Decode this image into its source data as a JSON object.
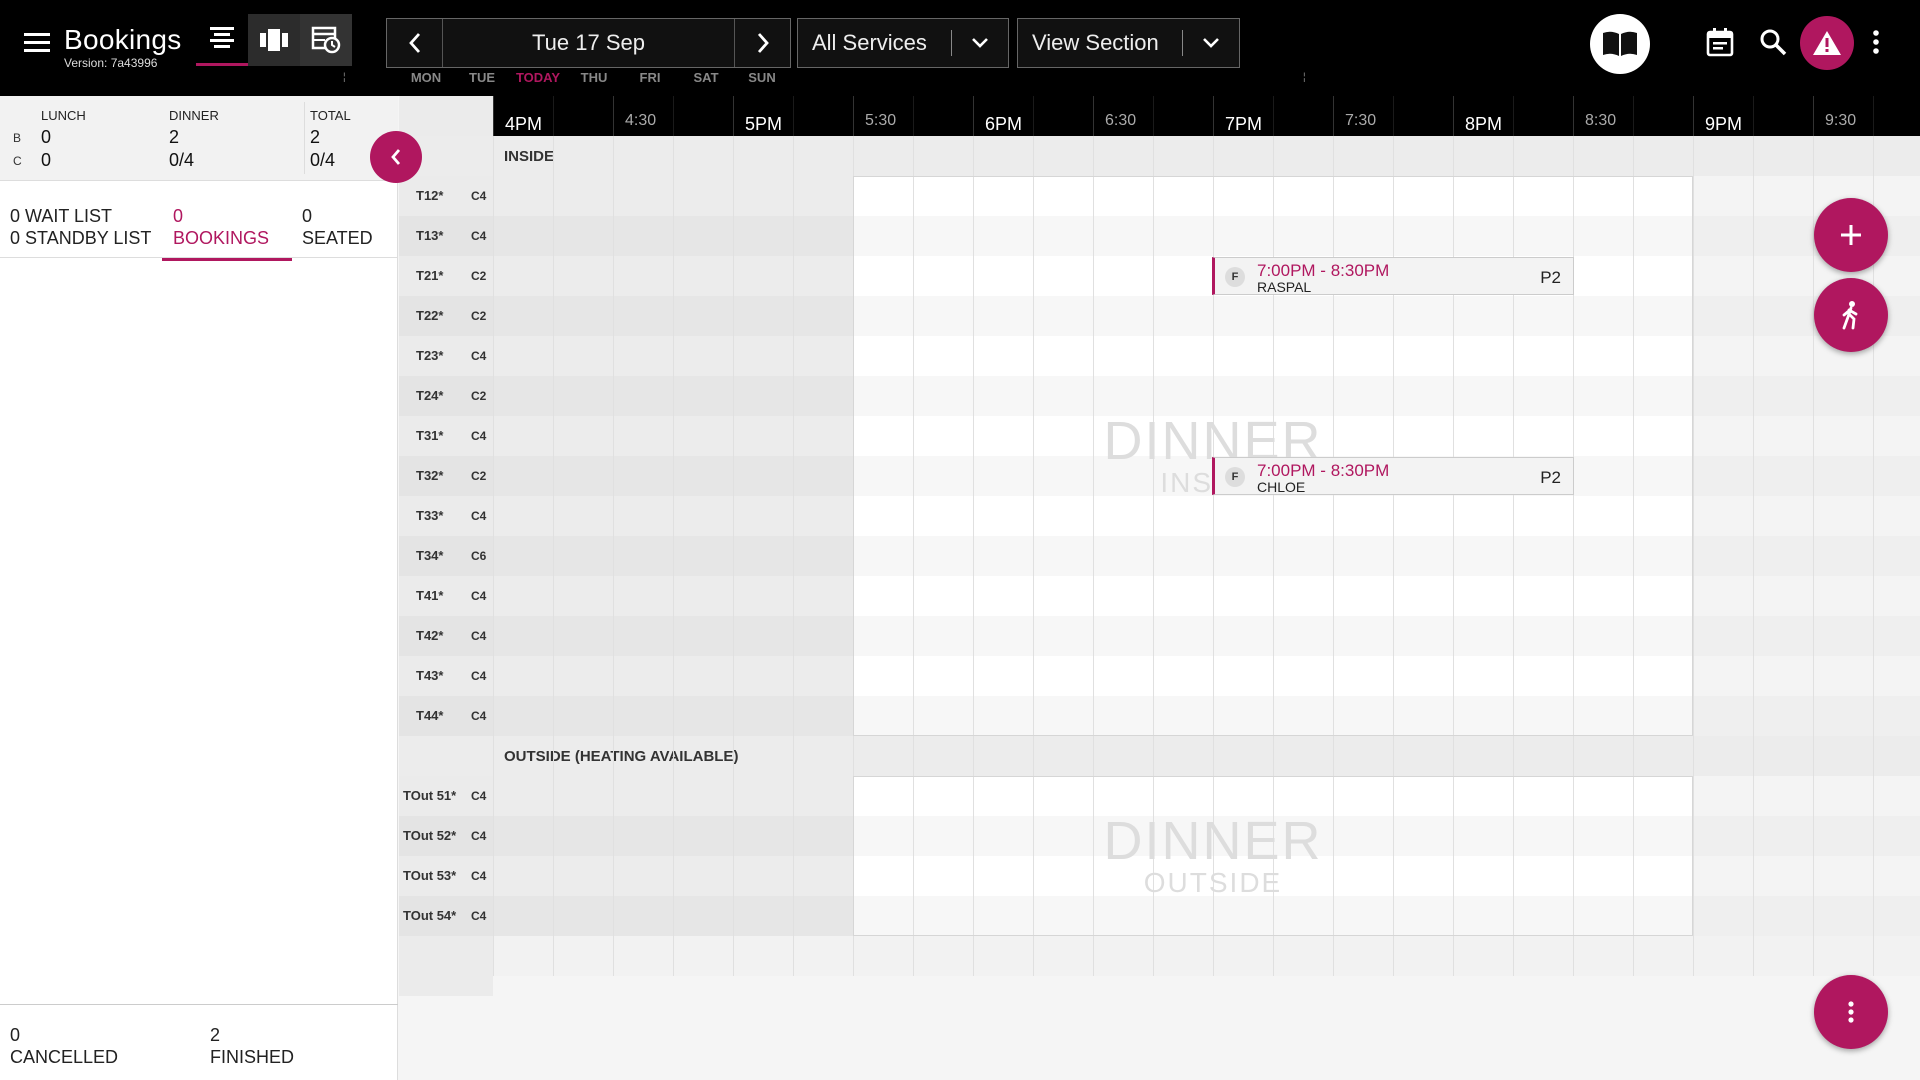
{
  "app": {
    "title": "Bookings",
    "version": "Version: 7a43996"
  },
  "date_nav": {
    "date": "Tue 17 Sep",
    "days": [
      "MON",
      "TUE",
      "TODAY",
      "THU",
      "FRI",
      "SAT",
      "SUN"
    ]
  },
  "filters": {
    "services": "All Services",
    "section": "View Section"
  },
  "stats": {
    "row_labels": [
      "B",
      "C"
    ],
    "columns": [
      {
        "header": "LUNCH",
        "b": "0",
        "c": "0"
      },
      {
        "header": "DINNER",
        "b": "2",
        "c": "0/4"
      },
      {
        "header": "TOTAL",
        "b": "2",
        "c": "0/4"
      }
    ]
  },
  "tabs": {
    "wait": {
      "count": "0",
      "label": "WAIT LIST"
    },
    "standby": {
      "count": "0",
      "label": "STANDBY LIST"
    },
    "bookings": {
      "count": "0",
      "label": "BOOKINGS"
    },
    "seated": {
      "count": "0",
      "label": "SEATED"
    }
  },
  "footer": {
    "cancelled": {
      "count": "0",
      "label": "CANCELLED"
    },
    "finished": {
      "count": "2",
      "label": "FINISHED"
    }
  },
  "timeline": {
    "hours": [
      "4PM",
      "5PM",
      "6PM",
      "7PM",
      "8PM",
      "9PM"
    ],
    "halves": [
      "4:30",
      "5:30",
      "6:30",
      "7:30",
      "8:30",
      "9:30"
    ],
    "sections": [
      {
        "name": "INSIDE",
        "watermark": "DINNER",
        "watermark_sub": "INSIDE",
        "tables": [
          {
            "name": "T12*",
            "cap": "C4"
          },
          {
            "name": "T13*",
            "cap": "C4"
          },
          {
            "name": "T21*",
            "cap": "C2"
          },
          {
            "name": "T22*",
            "cap": "C2"
          },
          {
            "name": "T23*",
            "cap": "C4"
          },
          {
            "name": "T24*",
            "cap": "C2"
          },
          {
            "name": "T31*",
            "cap": "C4"
          },
          {
            "name": "T32*",
            "cap": "C2"
          },
          {
            "name": "T33*",
            "cap": "C4"
          },
          {
            "name": "T34*",
            "cap": "C6"
          },
          {
            "name": "T41*",
            "cap": "C4"
          },
          {
            "name": "T42*",
            "cap": "C4"
          },
          {
            "name": "T43*",
            "cap": "C4"
          },
          {
            "name": "T44*",
            "cap": "C4"
          }
        ]
      },
      {
        "name": "OUTSIDE (HEATING AVAILABLE)",
        "watermark": "DINNER",
        "watermark_sub": "OUTSIDE",
        "tables": [
          {
            "name": "TOut 51*",
            "cap": "C4"
          },
          {
            "name": "TOut 52*",
            "cap": "C4"
          },
          {
            "name": "TOut 53*",
            "cap": "C4"
          },
          {
            "name": "TOut 54*",
            "cap": "C4"
          }
        ]
      }
    ],
    "bookings": [
      {
        "table": "T21*",
        "badge": "F",
        "time": "7:00PM - 8:30PM",
        "name": "RASPAL",
        "party": "P2"
      },
      {
        "table": "T32*",
        "badge": "F",
        "time": "7:00PM - 8:30PM",
        "name": "CHLOE",
        "party": "P2"
      }
    ]
  },
  "icons": [
    "menu-icon",
    "list-view-icon",
    "floor-view-icon",
    "schedule-icon",
    "chevron-left-icon",
    "chevron-right-icon",
    "chevron-down-icon",
    "book-icon",
    "calendar-icon",
    "search-icon",
    "alert-icon",
    "more-vert-icon",
    "plus-icon",
    "walk-in-icon"
  ],
  "colors": {
    "accent": "#b0175f",
    "topbar": "#000000"
  }
}
